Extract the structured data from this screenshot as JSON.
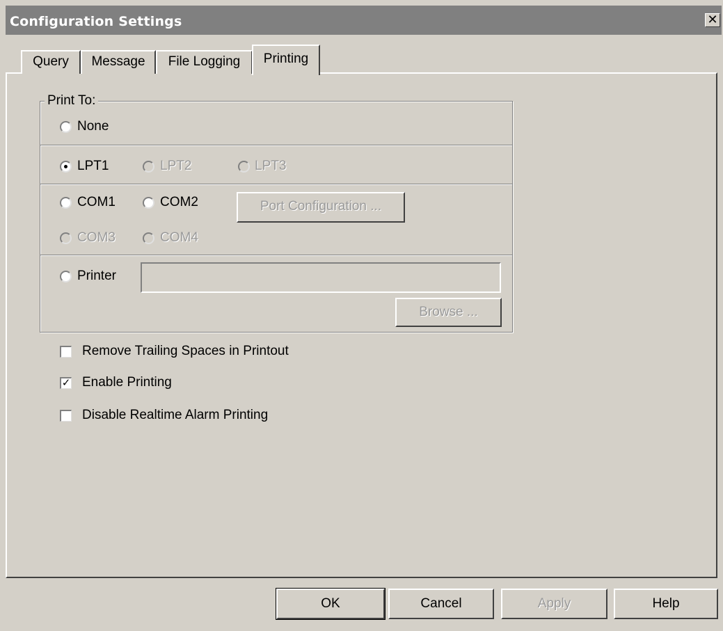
{
  "window": {
    "title": "Configuration Settings",
    "close_glyph": "✕"
  },
  "tabs": [
    {
      "label": "Query",
      "active": false
    },
    {
      "label": "Message",
      "active": false
    },
    {
      "label": "File Logging",
      "active": false
    },
    {
      "label": "Printing",
      "active": true
    }
  ],
  "print_to": {
    "label": "Print To:",
    "none": {
      "label": "None",
      "selected": false,
      "enabled": true
    },
    "lpt": [
      {
        "label": "LPT1",
        "selected": true,
        "enabled": true
      },
      {
        "label": "LPT2",
        "selected": false,
        "enabled": false
      },
      {
        "label": "LPT3",
        "selected": false,
        "enabled": false
      }
    ],
    "com": [
      {
        "label": "COM1",
        "selected": false,
        "enabled": true
      },
      {
        "label": "COM2",
        "selected": false,
        "enabled": true
      },
      {
        "label": "COM3",
        "selected": false,
        "enabled": false
      },
      {
        "label": "COM4",
        "selected": false,
        "enabled": false
      }
    ],
    "port_config_label": "Port Configuration ...",
    "printer": {
      "label": "Printer",
      "selected": false,
      "value": ""
    },
    "browse_label": "Browse ..."
  },
  "options": [
    {
      "label": "Remove Trailing Spaces in Printout",
      "checked": false
    },
    {
      "label": "Enable Printing",
      "checked": true
    },
    {
      "label": "Disable Realtime Alarm Printing",
      "checked": false
    }
  ],
  "buttons": {
    "ok": "OK",
    "cancel": "Cancel",
    "apply": "Apply",
    "help": "Help"
  },
  "colors": {
    "face": "#d4d0c8",
    "titlebar": "#808080",
    "disabled_text": "#9a9a9a"
  },
  "icons": {
    "close": "close-icon",
    "check": "checkmark-icon"
  }
}
